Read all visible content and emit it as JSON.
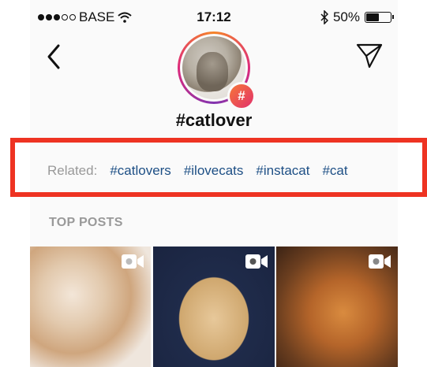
{
  "status_bar": {
    "carrier": "BASE",
    "time": "17:12",
    "battery": "50%",
    "battery_level": 0.5,
    "signal_dots_filled": 3,
    "signal_dots_total": 5
  },
  "header": {
    "hashtag": "#catlover",
    "badge_symbol": "#"
  },
  "related": {
    "label": "Related:",
    "tags": [
      "#catlovers",
      "#ilovecats",
      "#instacat",
      "#cat"
    ]
  },
  "sections": {
    "top_posts": "TOP POSTS"
  },
  "icons": {
    "back": "chevron-left-icon",
    "send": "paper-plane-icon",
    "wifi": "wifi-icon",
    "bluetooth": "bluetooth-icon",
    "video": "video-camera-icon"
  },
  "colors": {
    "link": "#1d4f85",
    "muted": "#999999",
    "highlight": "#ee3322",
    "badge_start": "#f77737",
    "badge_end": "#e1306c"
  }
}
